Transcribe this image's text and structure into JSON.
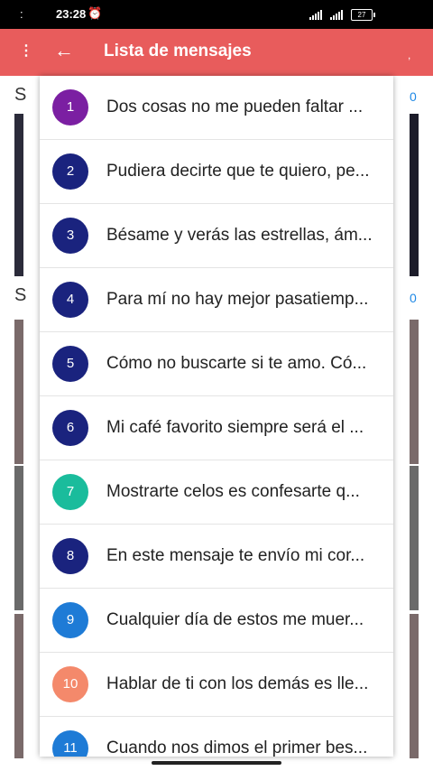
{
  "status_bar": {
    "dots": ":",
    "time": "23:28",
    "battery": "27"
  },
  "app_bar": {
    "title": "Lista de mensajes",
    "overflow_glyph": "⋮",
    "back_glyph": "←",
    "right_mark": ","
  },
  "background": {
    "left_letters": [
      "S",
      "S"
    ],
    "right_numbers": [
      "0",
      "0"
    ]
  },
  "messages": [
    {
      "num": "1",
      "text": "Dos cosas no me pueden faltar ...",
      "color": "#7b1fa2"
    },
    {
      "num": "2",
      "text": "Pudiera decirte que te quiero, pe...",
      "color": "#1a237e"
    },
    {
      "num": "3",
      "text": "Bésame y verás las estrellas, ám...",
      "color": "#1a237e"
    },
    {
      "num": "4",
      "text": "Para mí no hay mejor pasatiemp...",
      "color": "#1a237e"
    },
    {
      "num": "5",
      "text": "Cómo no buscarte si te amo. Có...",
      "color": "#1a237e"
    },
    {
      "num": "6",
      "text": "Mi café favorito siempre será el ...",
      "color": "#1a237e"
    },
    {
      "num": "7",
      "text": "Mostrarte celos es confesarte q...",
      "color": "#1abc9c"
    },
    {
      "num": "8",
      "text": "En este mensaje te envío mi cor...",
      "color": "#1a237e"
    },
    {
      "num": "9",
      "text": "Cualquier día de estos me muer...",
      "color": "#1e7bd6"
    },
    {
      "num": "10",
      "text": "Hablar de ti con los demás es lle...",
      "color": "#f4896b"
    },
    {
      "num": "11",
      "text": "Cuando nos dimos el primer bes...",
      "color": "#1e7bd6"
    }
  ]
}
